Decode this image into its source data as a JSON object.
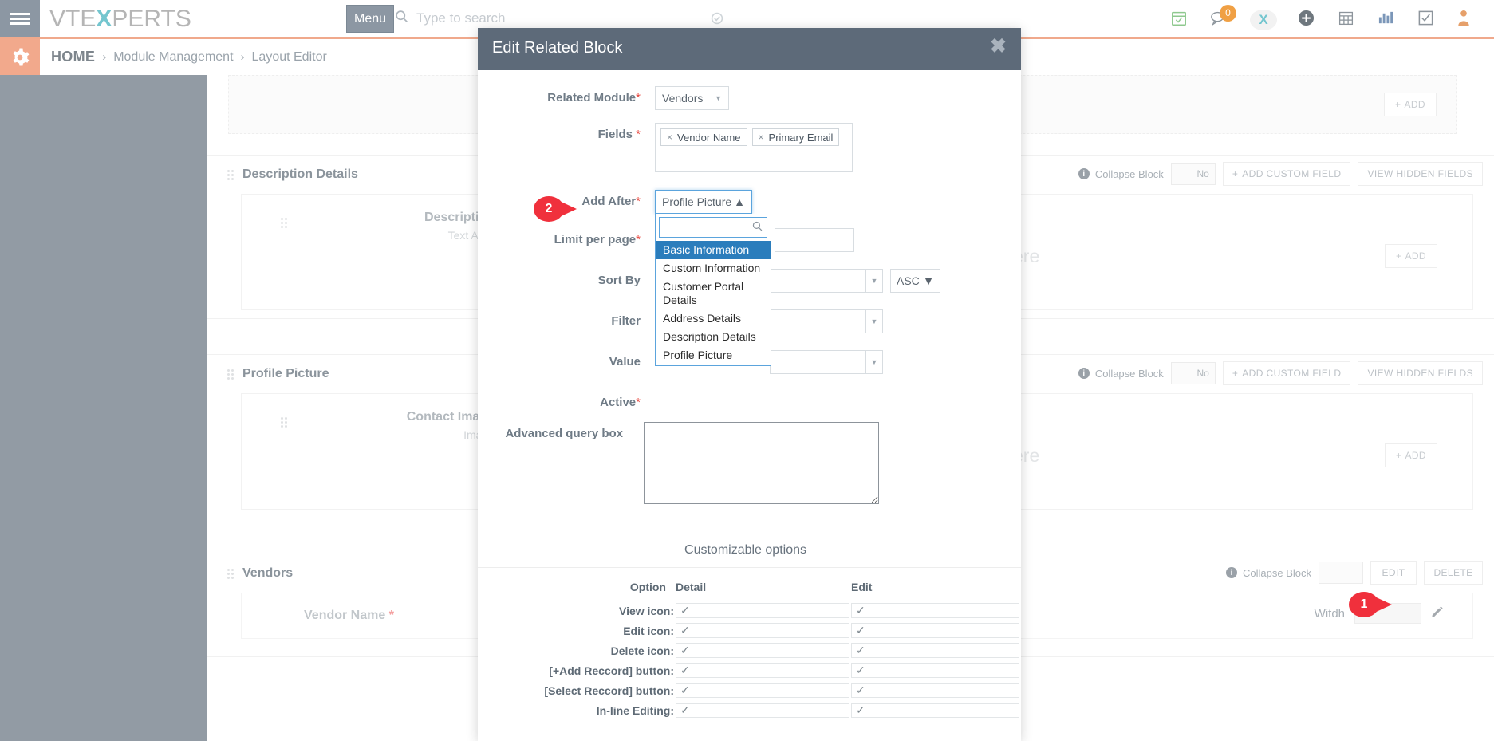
{
  "topbar": {
    "brand_pre": "VTE",
    "brand_x": "X",
    "brand_post": "PERTS",
    "menu_label": "Menu",
    "search_placeholder": "Type to search",
    "search_value": "",
    "notification_badge": "0",
    "x_mark": "X",
    "icons": [
      "calendar-check-icon",
      "chat-icon",
      "vtexperts-x-icon",
      "add-circle-icon",
      "calendar-icon",
      "analytics-icon",
      "tasks-icon",
      "user-icon"
    ]
  },
  "breadcrumb": {
    "home": "HOME",
    "sep": "›",
    "items": [
      "Module Management",
      "Layout Editor"
    ]
  },
  "canvas": {
    "add_new_field_here": "Add new field here",
    "add_label": "ADD",
    "collapse_block": "Collapse Block",
    "toggle_no": "No",
    "add_custom_field": "ADD CUSTOM FIELD",
    "view_hidden_fields": "VIEW HIDDEN FIELDS",
    "edit_label": "EDIT",
    "delete_label": "DELETE",
    "witdh_label": "Witdh",
    "witdh_value": "",
    "blocks": [
      {
        "title": "Description Details",
        "field_name": "Description",
        "field_type": "Text Area"
      },
      {
        "title": "Profile Picture",
        "field_name": "Contact Image",
        "field_type": "Image"
      },
      {
        "title": "Vendors",
        "field_name": "Vendor Name",
        "field_required": "*"
      }
    ]
  },
  "modal": {
    "title": "Edit Related Block",
    "close_glyph": "✖",
    "labels": {
      "related_module": "Related Module",
      "fields": "Fields ",
      "add_after": "Add After",
      "limit_per_page": "Limit per page",
      "sort_by": "Sort By",
      "filter": "Filter",
      "value": "Value",
      "active": "Active",
      "advanced_query_box": "Advanced query box"
    },
    "required_star": "*",
    "related_module_value": "Vendors",
    "fields_chips": [
      "Vendor Name",
      "Primary Email"
    ],
    "chip_x": "×",
    "add_after_value": "Profile Picture",
    "add_after_search_value": "",
    "add_after_options": [
      "Basic Information",
      "Custom Information",
      "Customer Portal Details",
      "Address Details",
      "Description Details",
      "Profile Picture"
    ],
    "add_after_highlighted": "Basic Information",
    "limit_per_page_value": "",
    "sort_by_value": "",
    "sort_dir_value": "ASC",
    "filter_value": "",
    "value_value": "",
    "advanced_query_value": "",
    "customizable_options": "Customizable options",
    "options_table": {
      "headers": [
        "Option",
        "Detail",
        "Edit"
      ],
      "check_glyph": "✓",
      "rows": [
        {
          "label": "View icon:",
          "detail": true,
          "edit": true
        },
        {
          "label": "Edit icon:",
          "detail": true,
          "edit": true
        },
        {
          "label": "Delete icon:",
          "detail": true,
          "edit": true
        },
        {
          "label": "[+Add Reccord] button:",
          "detail": true,
          "edit": true
        },
        {
          "label": "[Select Reccord] button:",
          "detail": true,
          "edit": true
        },
        {
          "label": "In-line Editing:",
          "detail": true,
          "edit": true
        }
      ]
    }
  },
  "markers": [
    {
      "number": "1"
    },
    {
      "number": "2"
    }
  ],
  "colors": {
    "accent_orange": "#f2a98c",
    "brand_teal": "#74c6cf",
    "modal_header": "#5d6a79",
    "marker_red": "#f0303c",
    "dropdown_highlight": "#2b7dbc",
    "required_red": "#e8453c",
    "sidebar_gray": "#929ba4"
  }
}
